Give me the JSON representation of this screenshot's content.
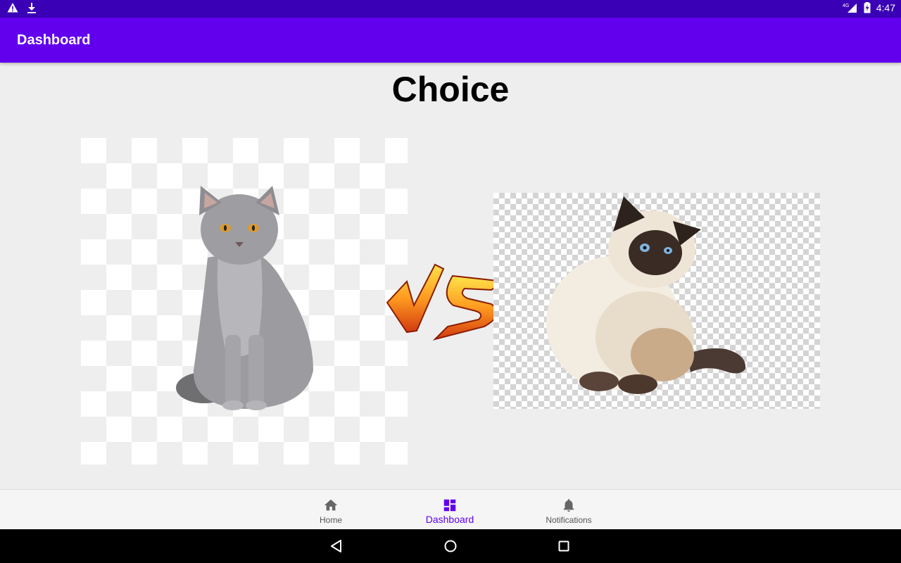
{
  "status_bar": {
    "left_icons": [
      "warning-icon",
      "download-icon"
    ],
    "network": "4G",
    "time": "4:47"
  },
  "app_bar": {
    "title": "Dashboard"
  },
  "main": {
    "title": "Choice",
    "left_image": {
      "subject": "grey cat",
      "icon": "cat-photo"
    },
    "right_image": {
      "subject": "himalayan cat",
      "icon": "cat-photo"
    },
    "versus_icon": "vs-emblem"
  },
  "bottom_nav": {
    "items": [
      {
        "label": "Home",
        "icon": "home-icon",
        "active": false
      },
      {
        "label": "Dashboard",
        "icon": "dashboard-icon",
        "active": true
      },
      {
        "label": "Notifications",
        "icon": "bell-icon",
        "active": false
      }
    ]
  },
  "system_nav": [
    "back-icon",
    "home-circle-icon",
    "recents-icon"
  ],
  "colors": {
    "status_bar": "#3a00b6",
    "app_bar": "#6200ee",
    "accent": "#6200ee",
    "background": "#eeeeee"
  }
}
